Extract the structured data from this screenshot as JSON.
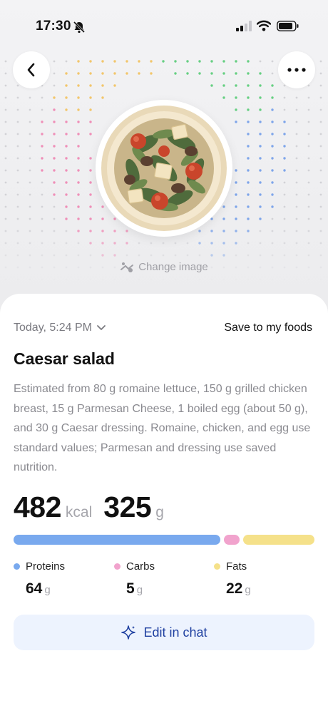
{
  "status_bar": {
    "time": "17:30",
    "icons": [
      "bell-slash-icon",
      "signal-icon",
      "wifi-icon",
      "battery-icon"
    ]
  },
  "header": {
    "back_icon": "chevron-left-icon",
    "more_icon": "more-dots-icon",
    "change_image_label": "Change image"
  },
  "entry": {
    "date": "Today, 5:24 PM",
    "save_label": "Save to my foods",
    "title": "Caesar salad",
    "description": "Estimated from 80 g romaine lettuce, 150 g grilled chicken breast, 15 g Parmesan Cheese, 1 boiled egg (about 50 g), and 30 g Caesar dressing. Romaine, chicken, and egg use standard values; Parmesan and dressing use saved nutrition.",
    "kcal": "482",
    "kcal_unit": "kcal",
    "weight": "325",
    "weight_unit": "g"
  },
  "macros": [
    {
      "label": "Proteins",
      "value": "64",
      "unit": "g",
      "color": "#79a9ee",
      "bar_fraction": 0.7
    },
    {
      "label": "Carbs",
      "value": "5",
      "unit": "g",
      "color": "#f1a3cd",
      "bar_fraction": 0.055
    },
    {
      "label": "Fats",
      "value": "22",
      "unit": "g",
      "color": "#f5e18a",
      "bar_fraction": 0.245
    }
  ],
  "actions": {
    "edit_label": "Edit in chat",
    "edit_icon": "sparkle-icon"
  }
}
